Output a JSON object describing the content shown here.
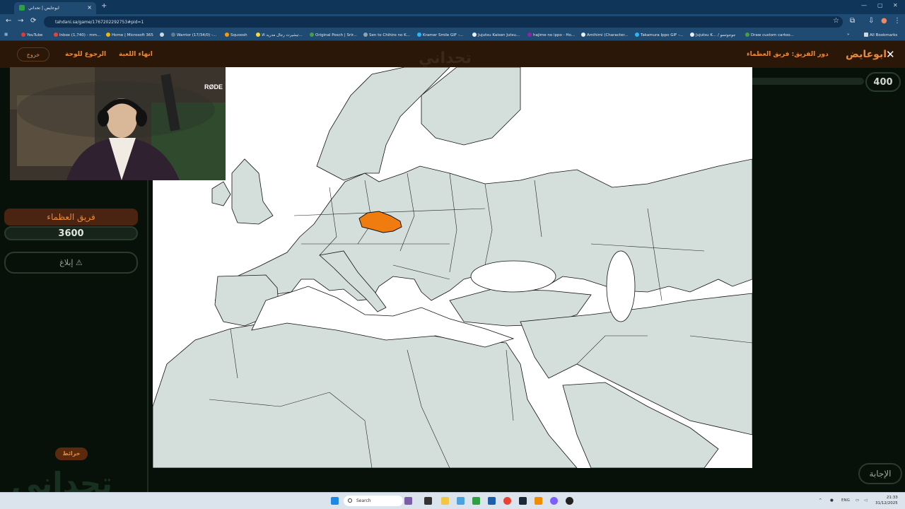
{
  "browser": {
    "tab_title": "ابوعايض | تحداني",
    "new_tab": "+",
    "url": "tahdani.sa/game/1767202292753#pid=1",
    "bookmarks": [
      "YouTube",
      "Inbox (1,740) - mm...",
      "Home | Microsoft 365",
      "Warrior (17/34/0) -...",
      "Squoosh",
      "تيشيرت رجال مدريد الا...",
      "Original Posch | Srir...",
      "Sen to Chihiro no K...",
      "Kramer Smile GIF -...",
      "Jujutsu Kaisen Jutsu...",
      "hajime no ippo - Ho...",
      "Amihimi (Character...",
      "Takamura Ippo GIF -...",
      "Jujutsu K... / جوجوتسو",
      "Draw custom cartoo..."
    ],
    "all_bookmarks": "All Bookmarks"
  },
  "nav": {
    "exit": "خروج",
    "back_to_board": "الرجوع للوحة",
    "end_game": "انهاء اللعبة",
    "turn_label": "دور الفريق:",
    "turn_team": "فريق العظماء",
    "player": "ابوعايض",
    "close": "✕"
  },
  "team": {
    "name": "فريق العظماء",
    "score": "3600",
    "report": "إبلاغ ⚠"
  },
  "question": {
    "points": "400",
    "category": "خرائط",
    "answer_button": "الإجابة"
  },
  "brand": {
    "logo_text": "تحداني",
    "webcam_mic_brand": "RØDE"
  },
  "taskbar": {
    "search_placeholder": "Search",
    "lang": "ENG",
    "time": "21:33",
    "date": "31/12/2025"
  },
  "colors": {
    "highlight": "#f07c10",
    "land": "#d4dedb",
    "sea": "#ffffff",
    "accent": "#e8893a"
  }
}
